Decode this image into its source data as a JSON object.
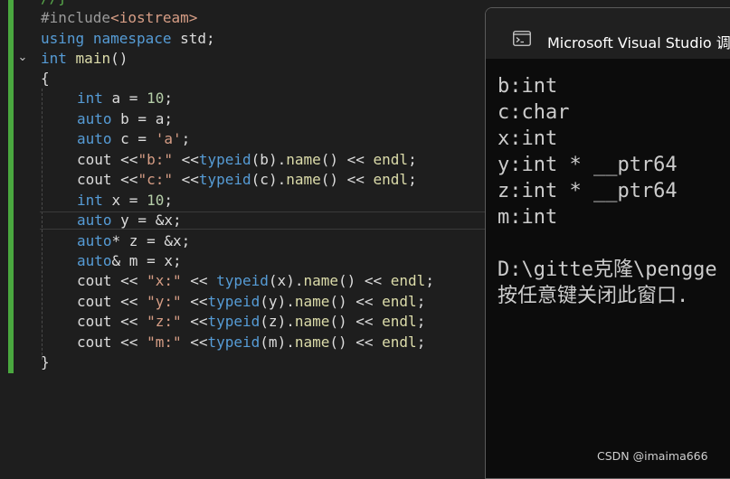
{
  "editor": {
    "lines": [
      {
        "parts": [
          [
            "cmt",
            "//}"
          ]
        ]
      },
      {
        "parts": [
          [
            "inc",
            "#include"
          ],
          [
            "incl",
            "<iostream>"
          ]
        ]
      },
      {
        "parts": [
          [
            "kw",
            "using"
          ],
          [
            "txt",
            " "
          ],
          [
            "kw",
            "namespace"
          ],
          [
            "txt",
            " std;"
          ]
        ]
      },
      {
        "parts": [
          [
            "kw",
            "int"
          ],
          [
            "txt",
            " "
          ],
          [
            "fn",
            "main"
          ],
          [
            "txt",
            "()"
          ]
        ]
      },
      {
        "parts": [
          [
            "txt",
            "{"
          ]
        ]
      },
      {
        "parts": [
          [
            "kw",
            "int"
          ],
          [
            "txt",
            " a = "
          ],
          [
            "num",
            "10"
          ],
          [
            "txt",
            ";"
          ]
        ]
      },
      {
        "parts": [
          [
            "kw",
            "auto"
          ],
          [
            "txt",
            " b = a;"
          ]
        ]
      },
      {
        "parts": [
          [
            "kw",
            "auto"
          ],
          [
            "txt",
            " c = "
          ],
          [
            "str",
            "'a'"
          ],
          [
            "txt",
            ";"
          ]
        ]
      },
      {
        "parts": [
          [
            "txt",
            "cout <<"
          ],
          [
            "str",
            "\"b:\""
          ],
          [
            "txt",
            " <<"
          ],
          [
            "kw",
            "typeid"
          ],
          [
            "txt",
            "(b)."
          ],
          [
            "fn",
            "name"
          ],
          [
            "txt",
            "() << "
          ],
          [
            "fn",
            "endl"
          ],
          [
            "txt",
            ";"
          ]
        ]
      },
      {
        "parts": [
          [
            "txt",
            "cout <<"
          ],
          [
            "str",
            "\"c:\""
          ],
          [
            "txt",
            " <<"
          ],
          [
            "kw",
            "typeid"
          ],
          [
            "txt",
            "(c)."
          ],
          [
            "fn",
            "name"
          ],
          [
            "txt",
            "() << "
          ],
          [
            "fn",
            "endl"
          ],
          [
            "txt",
            ";"
          ]
        ]
      },
      {
        "parts": [
          [
            "kw",
            "int"
          ],
          [
            "txt",
            " x = "
          ],
          [
            "num",
            "10"
          ],
          [
            "txt",
            ";"
          ]
        ]
      },
      {
        "parts": [
          [
            "kw",
            "auto"
          ],
          [
            "txt",
            " y = &x;"
          ]
        ]
      },
      {
        "parts": [
          [
            "kw",
            "auto"
          ],
          [
            "txt",
            "* z = &x;"
          ]
        ]
      },
      {
        "parts": [
          [
            "kw",
            "auto"
          ],
          [
            "txt",
            "& m = x;"
          ]
        ]
      },
      {
        "parts": [
          [
            "txt",
            "cout << "
          ],
          [
            "str",
            "\"x:\""
          ],
          [
            "txt",
            " << "
          ],
          [
            "kw",
            "typeid"
          ],
          [
            "txt",
            "(x)."
          ],
          [
            "fn",
            "name"
          ],
          [
            "txt",
            "() << "
          ],
          [
            "fn",
            "endl"
          ],
          [
            "txt",
            ";"
          ]
        ]
      },
      {
        "parts": [
          [
            "txt",
            "cout << "
          ],
          [
            "str",
            "\"y:\""
          ],
          [
            "txt",
            " <<"
          ],
          [
            "kw",
            "typeid"
          ],
          [
            "txt",
            "(y)."
          ],
          [
            "fn",
            "name"
          ],
          [
            "txt",
            "() << "
          ],
          [
            "fn",
            "endl"
          ],
          [
            "txt",
            ";"
          ]
        ]
      },
      {
        "parts": [
          [
            "txt",
            "cout << "
          ],
          [
            "str",
            "\"z:\""
          ],
          [
            "txt",
            " <<"
          ],
          [
            "kw",
            "typeid"
          ],
          [
            "txt",
            "(z)."
          ],
          [
            "fn",
            "name"
          ],
          [
            "txt",
            "() << "
          ],
          [
            "fn",
            "endl"
          ],
          [
            "txt",
            ";"
          ]
        ]
      },
      {
        "parts": [
          [
            "txt",
            "cout << "
          ],
          [
            "str",
            "\"m:\""
          ],
          [
            "txt",
            " <<"
          ],
          [
            "kw",
            "typeid"
          ],
          [
            "txt",
            "(m)."
          ],
          [
            "fn",
            "name"
          ],
          [
            "txt",
            "() << "
          ],
          [
            "fn",
            "endl"
          ],
          [
            "txt",
            ";"
          ]
        ]
      },
      {
        "parts": [
          [
            "txt",
            "}"
          ]
        ]
      }
    ],
    "colors": {
      "keyword": "#569cd6",
      "function": "#dcdcaa",
      "string": "#d69d85",
      "number": "#b5cea8",
      "gutter": "#4aa83f"
    },
    "fold_icon": "chevron-down-icon"
  },
  "console": {
    "title": "Microsoft Visual Studio 调",
    "icon": "terminal-icon",
    "output": [
      "b:int",
      "c:char",
      "x:int",
      "y:int * __ptr64",
      "z:int * __ptr64",
      "m:int",
      "",
      "D:\\gitte克隆\\pengge",
      "按任意键关闭此窗口."
    ]
  },
  "watermark": "CSDN @imaima666"
}
